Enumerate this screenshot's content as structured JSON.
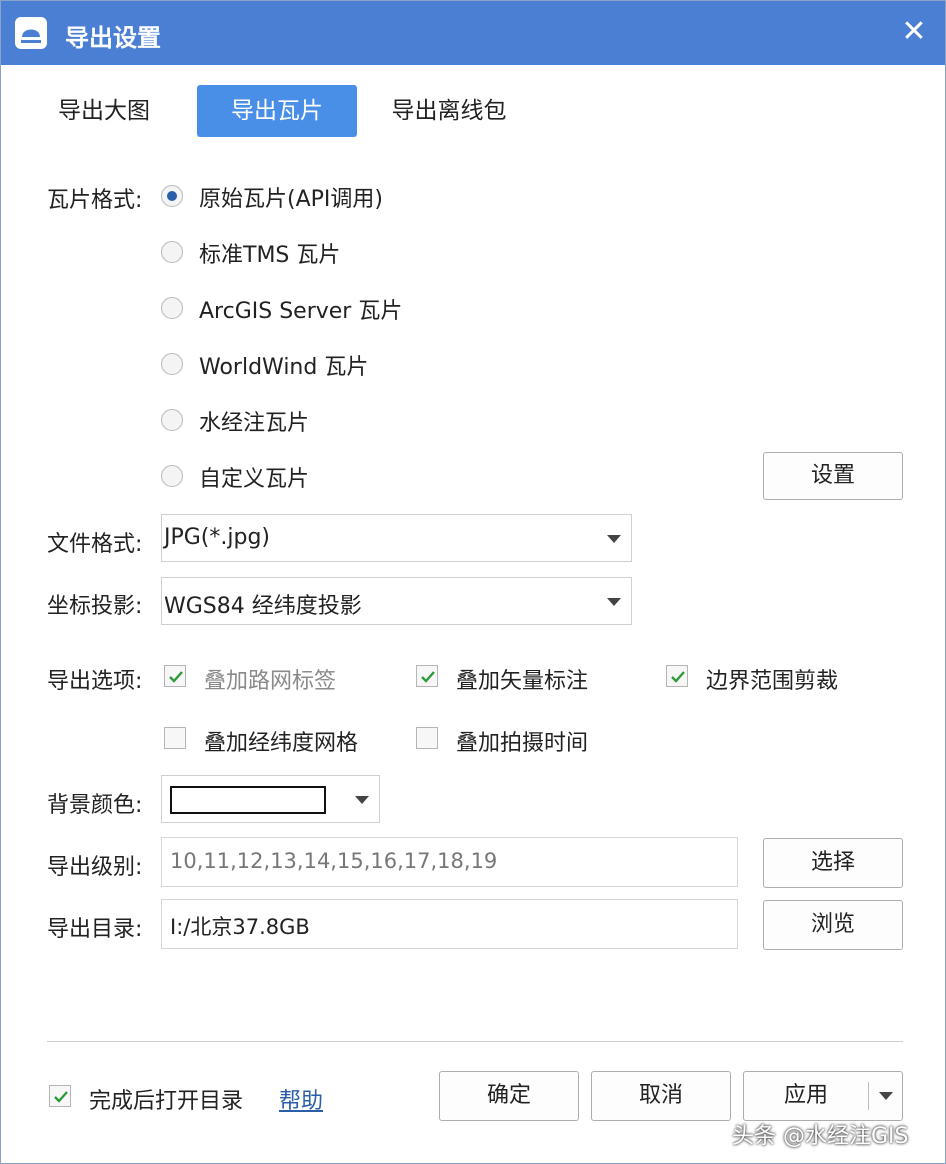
{
  "window": {
    "title": "导出设置",
    "close_glyph": "✕"
  },
  "tabs": [
    {
      "label": "导出大图"
    },
    {
      "label": "导出瓦片",
      "active": true
    },
    {
      "label": "导出离线包"
    }
  ],
  "tile_format": {
    "label": "瓦片格式:",
    "options": [
      {
        "label": "原始瓦片(API调用)",
        "checked": true
      },
      {
        "label": "标准TMS 瓦片"
      },
      {
        "label": "ArcGIS Server 瓦片"
      },
      {
        "label": "WorldWind 瓦片"
      },
      {
        "label": "水经注瓦片"
      },
      {
        "label": "自定义瓦片"
      }
    ],
    "settings_button": "设置"
  },
  "file_format": {
    "label": "文件格式:",
    "value": "JPG(*.jpg)"
  },
  "projection": {
    "label": "坐标投影:",
    "value": "WGS84 经纬度投影"
  },
  "export_options": {
    "label": "导出选项:",
    "items": [
      {
        "label": "叠加路网标签",
        "checked": true,
        "disabled": true
      },
      {
        "label": "叠加矢量标注",
        "checked": true
      },
      {
        "label": "边界范围剪裁",
        "checked": true
      },
      {
        "label": "叠加经纬度网格",
        "checked": false
      },
      {
        "label": "叠加拍摄时间",
        "checked": false
      }
    ]
  },
  "background_color": {
    "label": "背景颜色:",
    "value": "#ffffff"
  },
  "export_levels": {
    "label": "导出级别:",
    "value": "10,11,12,13,14,15,16,17,18,19",
    "button": "选择"
  },
  "export_dir": {
    "label": "导出目录:",
    "value": "I:/北京37.8GB",
    "button": "浏览"
  },
  "footer": {
    "open_after_done": {
      "label": "完成后打开目录",
      "checked": true
    },
    "help": "帮助",
    "ok": "确定",
    "cancel": "取消",
    "apply": "应用"
  },
  "watermark": "头条 @水经注GIS",
  "colors": {
    "titlebar": "#4a7fd4",
    "accent": "#4a8fe7",
    "check": "#2e9b3a"
  }
}
